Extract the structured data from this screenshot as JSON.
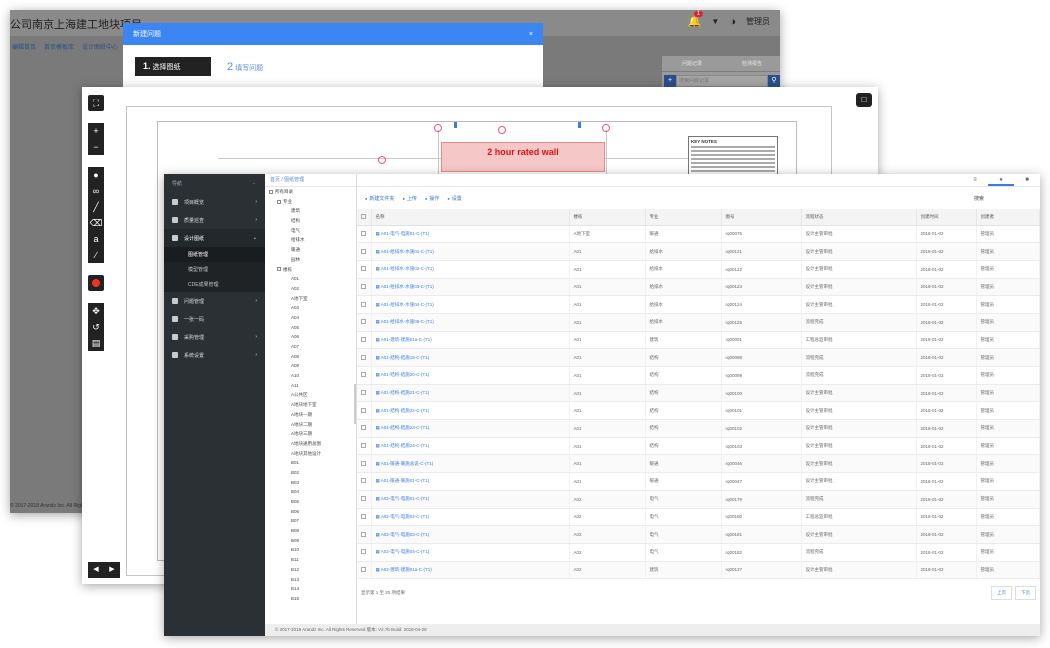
{
  "back_window": {
    "company": "公司南京上海建工地块项目",
    "bell_count": "1",
    "user": "管理员",
    "crumbs": [
      "编辑首页",
      "首页模板库",
      "设计图纸中心"
    ],
    "right_tabs": [
      "问题记录",
      "检测报告"
    ],
    "search_placeholder": "搜索问题记录",
    "footer": "© 2017-2018 Arandz Inc. All Rights Reserved"
  },
  "dialog": {
    "title": "新建问题",
    "close": "×",
    "step1_num": "1.",
    "step1_label": "选择图纸",
    "step2_num": "2",
    "step2_label": "填写问题"
  },
  "drawing": {
    "rated_wall_label": "2 hour rated wall",
    "notes_title": "KEY NOTES"
  },
  "front_window": {
    "sidebar_title": "导航",
    "sidebar_items": [
      {
        "label": "项目概览",
        "arrow": "›"
      },
      {
        "label": "质量巡查",
        "arrow": "›"
      },
      {
        "label": "设计图纸",
        "arrow": "⌄"
      }
    ],
    "sidebar_subitems": [
      "图纸管理",
      "模型管理",
      "CDE成果管理"
    ],
    "sidebar_items_2": [
      {
        "label": "问题管理",
        "arrow": "›"
      },
      {
        "label": "一张一码",
        "arrow": ""
      },
      {
        "label": "采购管理",
        "arrow": "›"
      },
      {
        "label": "系统设置",
        "arrow": "›"
      }
    ],
    "crumb": "首页 / 图纸管理",
    "tree_root": "所有目录",
    "tree_nodes": [
      "专业",
      "建筑",
      "结构",
      "电气",
      "给排水",
      "暖通",
      "园林",
      "楼栋",
      "A01",
      "A02",
      "A地下室",
      "A03",
      "A04",
      "A05",
      "A06",
      "A07",
      "A08",
      "A09",
      "A10",
      "A11",
      "A公共区",
      "A地块地下室",
      "A地块一期",
      "A地块二期",
      "A地块三期",
      "A地块通用总图",
      "A地块其他设计",
      "B01",
      "B02",
      "B03",
      "B04",
      "B05",
      "B06",
      "B07",
      "B08",
      "B09",
      "B10",
      "B11",
      "B12",
      "B13",
      "B14",
      "B15"
    ],
    "top_tabs": [
      "≡",
      "●",
      "■"
    ],
    "search_label": "搜索",
    "actions": [
      "新建文件夹",
      "上传",
      "操作",
      "设置"
    ],
    "columns": [
      "名称",
      "楼栋",
      "专业",
      "图号",
      "流程状态",
      "创建时间",
      "创建者"
    ],
    "rows": [
      [
        "A01-电气-电施01-C-(T1)",
        "A地下室",
        "暖通",
        "rq00075",
        "设计主管审批",
        "2018-01-02",
        "管理员"
      ],
      [
        "A01-给排水-水施01-C-(T1)",
        "A01",
        "给排水",
        "rq00121",
        "设计主管审批",
        "2018-01-02",
        "管理员"
      ],
      [
        "A01-给排水-水施02-C-(T1)",
        "A01",
        "给排水",
        "rq00122",
        "设计主管审批",
        "2018-01-02",
        "管理员"
      ],
      [
        "A01-给排水-水施03-C-(T1)",
        "A01",
        "给排水",
        "rq00123",
        "设计主管审批",
        "2018-01-02",
        "管理员"
      ],
      [
        "A01-给排水-水施04-C-(T1)",
        "A01",
        "给排水",
        "rq00124",
        "设计主管审批",
        "2018-01-02",
        "管理员"
      ],
      [
        "A01-给排水-水施05-C-(T1)",
        "A01",
        "给排水",
        "rq00125",
        "流程完成",
        "2018-01-02",
        "管理员"
      ],
      [
        "A01-建筑-建施01a-C-(T1)",
        "A01",
        "建筑",
        "rq00001",
        "工程总监审批",
        "2018-01-02",
        "管理员"
      ],
      [
        "A01-结构-结施19-C-(T1)",
        "A01",
        "结构",
        "rq00098",
        "流程完成",
        "2018-01-02",
        "管理员"
      ],
      [
        "A01-结构-结施20-C-(T1)",
        "A01",
        "结构",
        "rq00099",
        "流程完成",
        "2018-01-02",
        "管理员"
      ],
      [
        "A01-结构-结施21-C-(T1)",
        "A01",
        "结构",
        "rq00100",
        "设计主管审批",
        "2018-01-02",
        "管理员"
      ],
      [
        "A01-结构-结施22-C-(T1)",
        "A01",
        "结构",
        "rq00101",
        "设计主管审批",
        "2018-01-02",
        "管理员"
      ],
      [
        "A01-结构-结施23-C-(T1)",
        "A01",
        "结构",
        "rq00102",
        "设计主管审批",
        "2018-01-02",
        "管理员"
      ],
      [
        "A01-结构-结施24-C-(T1)",
        "A01",
        "结构",
        "rq00103",
        "设计主管审批",
        "2018-01-02",
        "管理员"
      ],
      [
        "A01-暖通-暖施总说-C-(T1)",
        "A01",
        "暖通",
        "rq00046",
        "设计主管审批",
        "2018-01-02",
        "管理员"
      ],
      [
        "A01-暖通-暖施01-C-(T1)",
        "A01",
        "暖通",
        "rq00047",
        "设计主管审批",
        "2018-01-02",
        "管理员"
      ],
      [
        "A02-电气-电施01-C-(T1)",
        "A02",
        "电气",
        "rq00179",
        "流程完成",
        "2018-01-02",
        "管理员"
      ],
      [
        "A02-电气-电施02-C-(T1)",
        "A02",
        "电气",
        "rq00180",
        "工程总监审批",
        "2018-01-02",
        "管理员"
      ],
      [
        "A02-电气-电施03-C-(T1)",
        "A02",
        "电气",
        "rq00181",
        "设计主管审批",
        "2018-01-02",
        "管理员"
      ],
      [
        "A02-电气-电施04-C-(T1)",
        "A02",
        "电气",
        "rq00182",
        "流程完成",
        "2018-01-02",
        "管理员"
      ],
      [
        "A02-建筑-建施01a-C-(T1)",
        "A02",
        "建筑",
        "rq00127",
        "设计主管审批",
        "2018-01-02",
        "管理员"
      ]
    ],
    "total": "显示第 1 至 20 项结果",
    "pager": [
      "上页",
      "下页"
    ],
    "status": "© 2017-2018 Arandz Inc. All Rights Reserved   版本: V2.7b   Build: 2018-04-28"
  },
  "icons": {
    "fullscreen": "fullscreen-icon",
    "zoom_in": "zoom-in-icon",
    "zoom_out": "zoom-out-icon",
    "pin": "pin-icon",
    "link": "link-icon",
    "pen": "pen-icon",
    "eraser": "eraser-icon",
    "text": "text-icon",
    "measure": "measure-icon",
    "record": "record-icon",
    "move": "move-icon",
    "rotate": "rotate-icon",
    "delete": "trash-icon",
    "chat": "chat-icon"
  },
  "colors": {
    "accent": "#3b86f2",
    "sidebar": "#2b3034",
    "rated": "#d11111"
  }
}
